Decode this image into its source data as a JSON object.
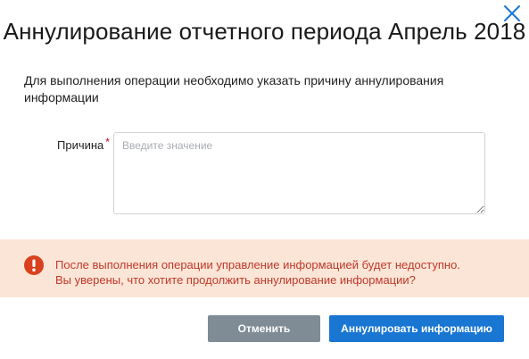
{
  "dialog": {
    "title": "Аннулирование отчетного периода Апрель 2018",
    "description": "Для выполнения операции необходимо указать причину аннулирования информации",
    "close_icon": "close-icon",
    "colors": {
      "accent": "#1976d2",
      "cancel": "#7f8b95",
      "warning_bg": "#fbe5d6",
      "warning_text": "#c0392b",
      "required": "#d0021b"
    }
  },
  "form": {
    "reason_label": "Причина",
    "required_mark": "*",
    "reason_placeholder": "Введите значение",
    "reason_value": ""
  },
  "warning": {
    "icon": "exclamation-icon",
    "line1": "После выполнения операции управление информацией будет недоступно.",
    "line2": "Вы уверены, что хотите продолжить аннулирование информации?"
  },
  "actions": {
    "cancel_label": "Отменить",
    "confirm_label": "Аннулировать информацию"
  }
}
